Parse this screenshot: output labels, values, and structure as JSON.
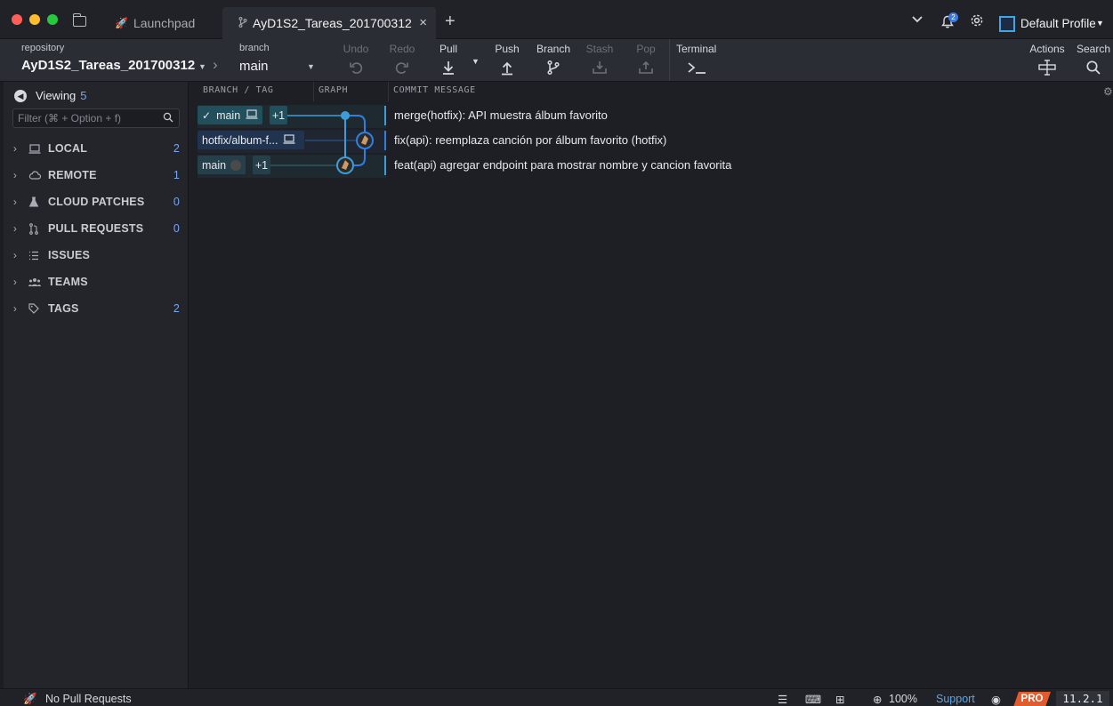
{
  "tabs": {
    "launchpad": "Launchpad",
    "repo": "AyD1S2_Tareas_201700312",
    "close": "×",
    "add": "+"
  },
  "topbar": {
    "notification_count": "2",
    "profile": "Default Profile"
  },
  "toolbar": {
    "repo_label": "repository",
    "repo_name": "AyD1S2_Tareas_201700312",
    "branch_label": "branch",
    "branch_name": "main",
    "undo": "Undo",
    "redo": "Redo",
    "pull": "Pull",
    "push": "Push",
    "branch": "Branch",
    "stash": "Stash",
    "pop": "Pop",
    "terminal": "Terminal",
    "actions": "Actions",
    "search": "Search"
  },
  "sidebar": {
    "viewing_label": "Viewing",
    "viewing_count": "5",
    "filter_placeholder": "Filter (⌘ + Option + f)",
    "sections": [
      {
        "label": "LOCAL",
        "count": "2",
        "icon": "laptop-icon"
      },
      {
        "label": "REMOTE",
        "count": "1",
        "icon": "cloud-icon"
      },
      {
        "label": "CLOUD PATCHES",
        "count": "0",
        "icon": "flask-icon"
      },
      {
        "label": "PULL REQUESTS",
        "count": "0",
        "icon": "pull-request-icon"
      },
      {
        "label": "ISSUES",
        "count": "",
        "icon": "list-icon"
      },
      {
        "label": "TEAMS",
        "count": "",
        "icon": "team-icon"
      },
      {
        "label": "TAGS",
        "count": "2",
        "icon": "tag-icon"
      }
    ]
  },
  "graph": {
    "col_branch": "BRANCH / TAG",
    "col_graph": "GRAPH",
    "col_message": "COMMIT MESSAGE",
    "rows": [
      {
        "branch": "main",
        "extra": "+1",
        "message": "merge(hotfix): API muestra álbum favorito"
      },
      {
        "branch": "hotfix/album-f...",
        "extra": "",
        "message": "fix(api): reemplaza canción por álbum favorito (hotfix)"
      },
      {
        "branch": "main",
        "extra": "+1",
        "message": "feat(api) agregar endpoint para mostrar nombre y cancion favorita"
      }
    ]
  },
  "statusbar": {
    "pull_requests": "No Pull Requests",
    "zoom": "100%",
    "support": "Support",
    "pro": "PRO",
    "version": "11.2.1"
  },
  "colors": {
    "accent": "#3d9dd8",
    "hotfix_line": "#2f7fe0",
    "pro": "#e25b2c"
  }
}
